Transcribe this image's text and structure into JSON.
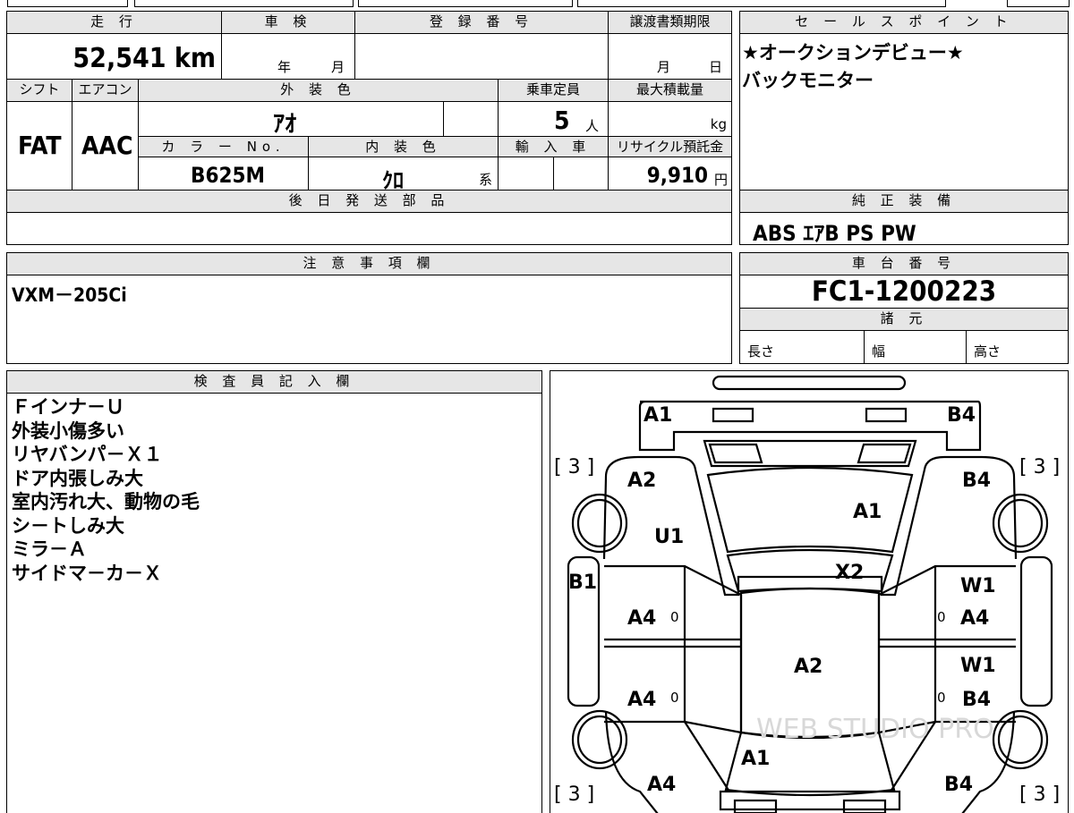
{
  "top_headers": {
    "mileage": "走 行",
    "inspection": "車 検",
    "registration": "登 録 番 号",
    "transfer_deadline": "譲渡書類期限",
    "sales_point": "セ ー ル ス ポ イ ン ト"
  },
  "mileage_value": "52,541 km",
  "inspection_year": "年",
  "inspection_month": "月",
  "transfer_month": "月",
  "transfer_day": "日",
  "sales_points": [
    "★オークションデビュー★",
    "バックモニター"
  ],
  "row2_headers": {
    "shift": "シフト",
    "aircon": "エアコン",
    "exterior_color": "外 装 色",
    "capacity": "乗車定員",
    "max_load": "最大積載量"
  },
  "shift_value": "FAT",
  "aircon_value": "AAC",
  "exterior_color_value": "ｱｵ",
  "capacity_value": "5",
  "capacity_unit": "人",
  "max_load_unit": "kg",
  "row3_headers": {
    "color_no": "カ ラ ー No.",
    "interior_color": "内 装 色",
    "imported": "輸 入 車",
    "recycle_fee": "リサイクル預託金"
  },
  "color_no_value": "B625M",
  "interior_color_value": "ｸﾛ",
  "interior_suffix": "系",
  "recycle_fee_value": "9,910",
  "recycle_fee_unit": "円",
  "later_shipping_header": "後 日 発 送 部 品",
  "standard_equipment_header": "純 正 装 備",
  "standard_equipment_value": "ABS ｴｱB PS PW",
  "notes_header": "注 意 事 項 欄",
  "notes_value": "VXM－205Ci",
  "chassis_header": "車 台 番 号",
  "chassis_value": "FC1-1200223",
  "specs_header": "諸 元",
  "specs_labels": [
    "長さ",
    "幅",
    "高さ"
  ],
  "inspector_header": "検 査 員 記 入 欄",
  "inspector_remarks": [
    "Ｆインナ－Ｕ",
    "外装小傷多い",
    "リヤバンパ－Ｘ１",
    "ドア内張しみ大",
    "室内汚れ大、動物の毛",
    "シ－トしみ大",
    "ミラ－Ａ",
    "サイドマ－カ－Ｘ"
  ],
  "diagram_marks": {
    "front_left": "A1",
    "front_right": "B4",
    "tire_fl": "[ 3 ]",
    "tire_fr": "[ 3 ]",
    "tire_rl": "[ 3 ]",
    "tire_rr": "[ 3 ]",
    "fender_fl": "A2",
    "fender_fr": "B4",
    "hood": "A1",
    "fender_fl2": "U1",
    "windshield": "X2",
    "pillar_left": "B1",
    "door_fl_w": "W1",
    "door_fl": "A4",
    "door_fl_0": "0",
    "door_fr_0": "0",
    "door_fr": "A4",
    "roof": "A2",
    "door_rr_w": "W1",
    "door_rl": "A4",
    "door_rl_0": "0",
    "door_rr_0": "0",
    "door_rr": "B4",
    "trunk": "A1",
    "rear_left": "A4",
    "rear_right": "B4"
  },
  "watermark": "WEB STUDIO PRO"
}
